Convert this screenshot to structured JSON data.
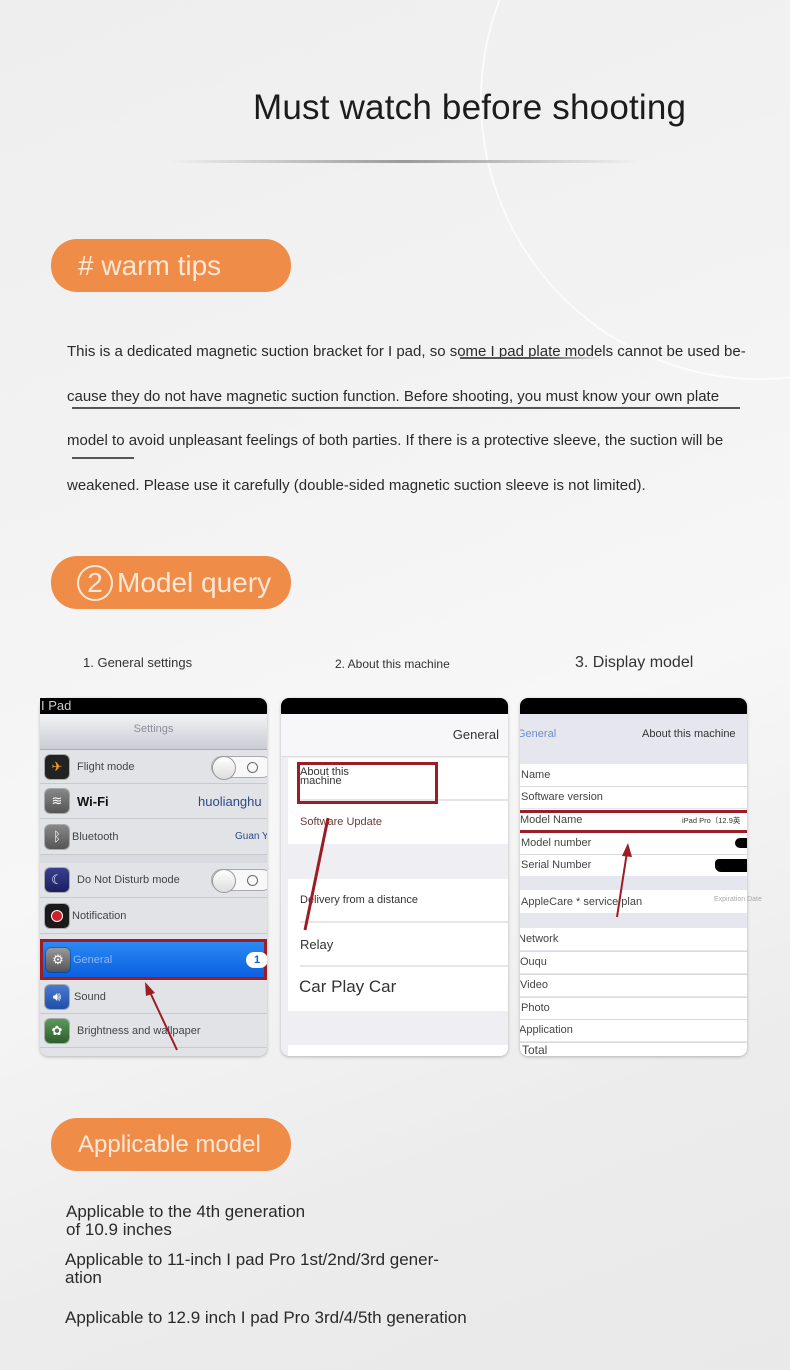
{
  "page": {
    "title": "Must watch before shooting"
  },
  "sections": {
    "warm_tips": {
      "heading": "# warm tips",
      "paragraph_lines": [
        "This is a dedicated magnetic suction bracket for I pad, so some I pad plate models cannot be used be-",
        "cause they do not have magnetic suction function. Before shooting, you must know your own plate",
        "model to avoid unpleasant feelings of both parties. If there is a protective sleeve, the suction will be",
        "weakened. Please use it carefully (double-sided magnetic suction sleeve is not limited)."
      ]
    },
    "model_query": {
      "number": "2",
      "heading": "Model query",
      "steps": [
        "1. General settings",
        "2. About this machine",
        "3. Display model"
      ]
    },
    "applicable_model": {
      "heading": "Applicable model",
      "items": [
        "Applicable to the 4th generation\nof 10.9 inches",
        "Applicable to 11-inch I pad Pro 1st/2nd/3rd gener-\nation",
        "Applicable to 12.9 inch I pad Pro 3rd/4/5th generation"
      ]
    }
  },
  "screen1": {
    "device_label": "I Pad",
    "nav_title": "Settings",
    "rows": [
      {
        "label": "Flight mode",
        "icon": "airplane-icon",
        "toggle": "off"
      },
      {
        "label": "Wi-Fi",
        "icon": "wifi-icon",
        "value": "huolianghu"
      },
      {
        "label": "Bluetooth",
        "icon": "bluetooth-icon",
        "value": "Guan Yue"
      },
      {
        "label": "Do Not Disturb mode",
        "icon": "moon-icon",
        "toggle": "off"
      },
      {
        "label": "Notification",
        "icon": "notification-icon"
      },
      {
        "label": "General",
        "icon": "gear-icon",
        "badge": "1",
        "highlighted": true
      },
      {
        "label": "Sound",
        "icon": "speaker-icon"
      },
      {
        "label": "Brightness and wallpaper",
        "icon": "flower-icon"
      }
    ]
  },
  "screen2": {
    "nav_title": "General",
    "group1": [
      "About this\nmachine",
      "Software Update"
    ],
    "group2": [
      "Delivery from a distance",
      "Relay",
      "Car Play Car"
    ]
  },
  "screen3": {
    "back_label": "General",
    "nav_title": "About this machine",
    "rows": [
      {
        "label": "Name",
        "value": ""
      },
      {
        "label": "Software version",
        "value": ""
      },
      {
        "label": "Model Name",
        "value": "iPad Pro（12.9英"
      },
      {
        "label": "Model number",
        "value": ""
      },
      {
        "label": "Serial Number",
        "value": ""
      }
    ],
    "applecare": {
      "label": "AppleCare * service plan",
      "value": "Expiration Date"
    },
    "rows2": [
      "Network",
      "Ouqu",
      "Video",
      "Photo",
      "Application",
      "Total"
    ]
  },
  "colors": {
    "accent_orange": "#ef8c48",
    "highlight_red": "#9b1d25",
    "ios_blue": "#0a5fe0"
  }
}
